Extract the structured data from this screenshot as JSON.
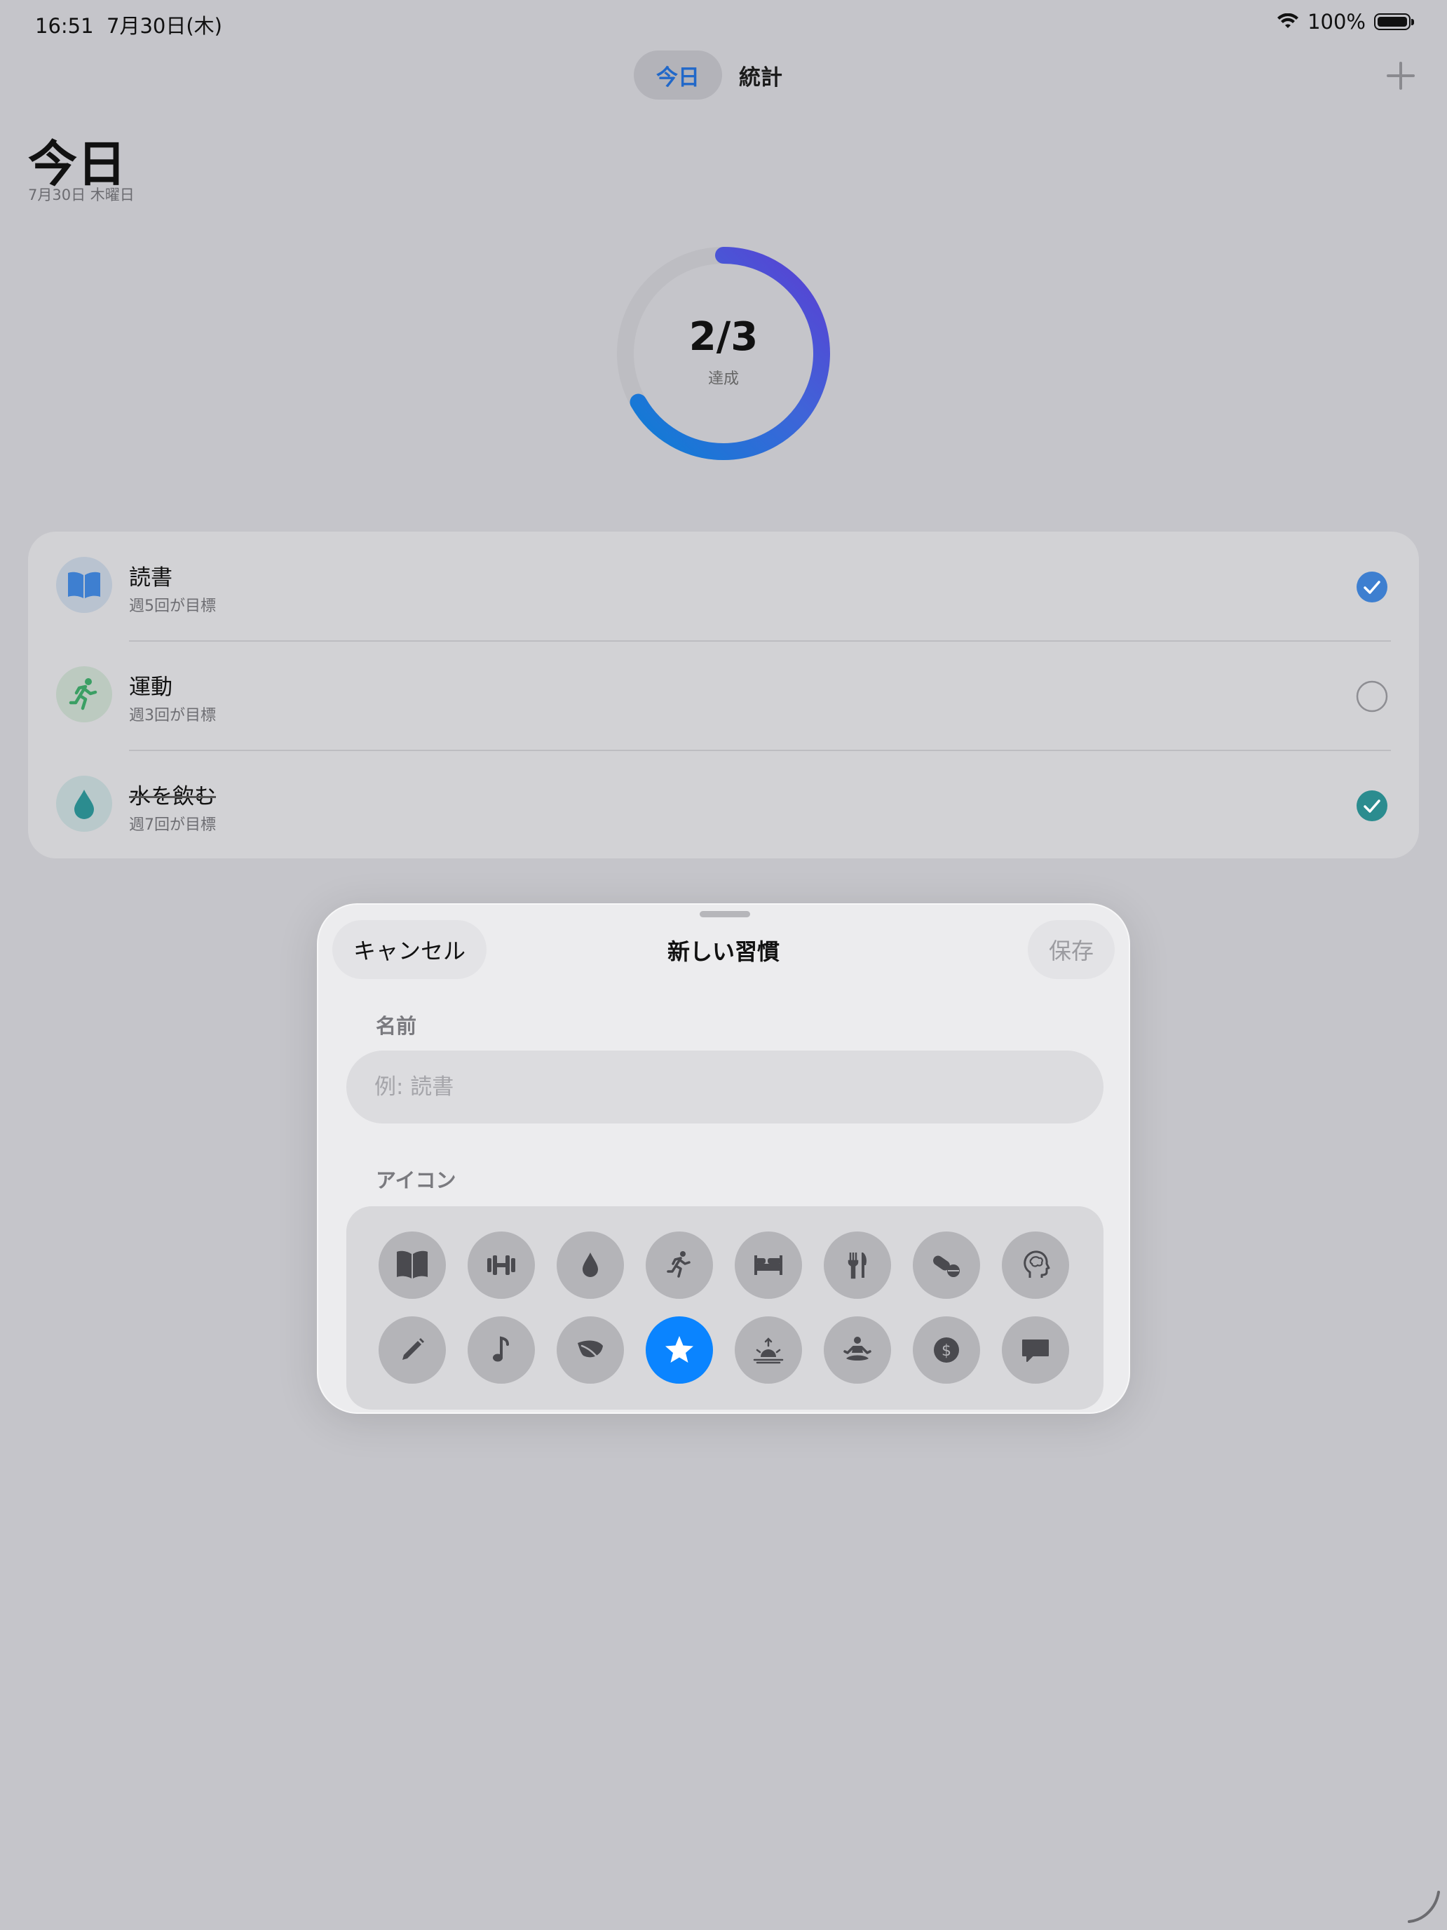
{
  "status": {
    "time": "16:51  7月30日(木)",
    "battery": "100%"
  },
  "nav": {
    "tabs": [
      {
        "label": "今日",
        "active": true
      },
      {
        "label": "統計",
        "active": false
      }
    ],
    "add_icon": "plus-icon"
  },
  "header": {
    "title": "今日",
    "date": "7月30日 木曜日"
  },
  "progress": {
    "text": "2/3",
    "label": "達成",
    "fraction": 0.667
  },
  "habits": [
    {
      "title": "読書",
      "subtitle": "週5回が目標",
      "icon": "book-icon",
      "done": true,
      "color": "#3e7fd0"
    },
    {
      "title": "運動",
      "subtitle": "週3回が目標",
      "icon": "running-icon",
      "done": false,
      "color": "#3b9f64"
    },
    {
      "title": "水を飲む",
      "subtitle": "週7回が目標",
      "icon": "drop-icon",
      "done": true,
      "color": "#2b8c8f"
    }
  ],
  "sheet": {
    "cancel": "キャンセル",
    "title": "新しい習慣",
    "save": "保存",
    "name_label": "名前",
    "name_placeholder": "例: 読書",
    "icon_label": "アイコン",
    "icons": [
      "book-icon",
      "dumbbell-icon",
      "drop-icon",
      "running-icon",
      "bed-icon",
      "fork-knife-icon",
      "pills-icon",
      "brain-head-icon",
      "pencil-icon",
      "music-note-icon",
      "leaf-icon",
      "star-icon",
      "sunrise-icon",
      "meditation-icon",
      "dollar-icon",
      "speech-bubble-icon"
    ],
    "selected_icon": "star-icon"
  },
  "colors": {
    "accent": "#0a84ff",
    "ring_start": "#0a7fd6",
    "ring_end": "#5a3fd3"
  }
}
